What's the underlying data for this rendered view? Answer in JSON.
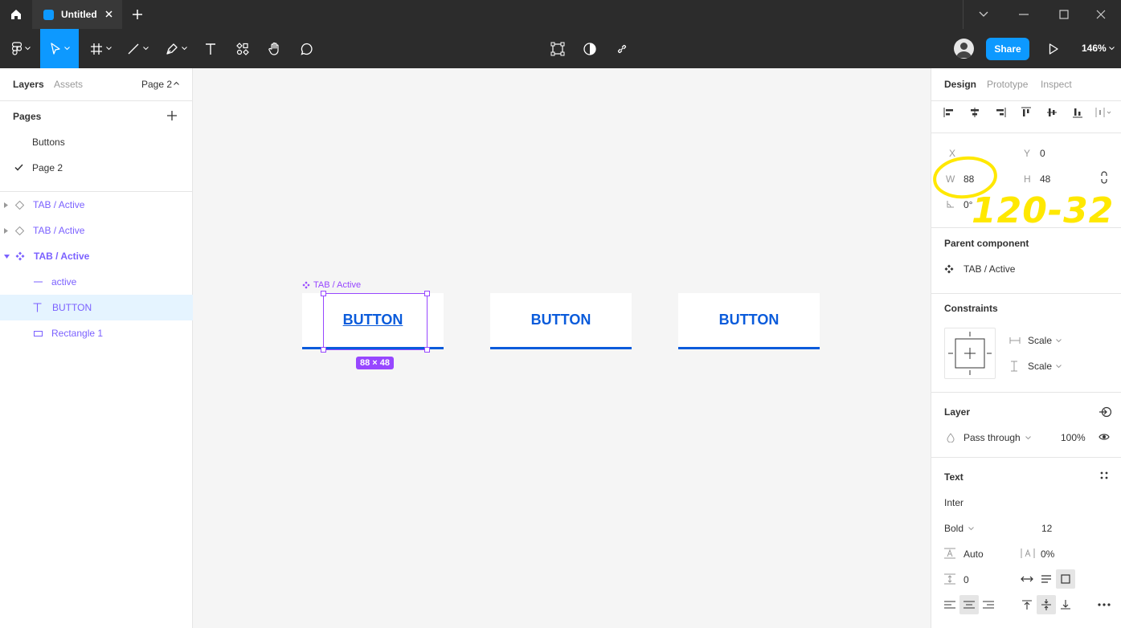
{
  "titlebar": {
    "tab_title": "Untitled"
  },
  "toolbar": {
    "share_label": "Share",
    "zoom_label": "146%"
  },
  "left_panel": {
    "tabs": {
      "layers": "Layers",
      "assets": "Assets",
      "page_dropdown": "Page 2"
    },
    "pages_title": "Pages",
    "pages": [
      {
        "label": "Buttons"
      },
      {
        "label": "Page 2"
      }
    ],
    "layers": [
      {
        "label": "TAB / Active"
      },
      {
        "label": "TAB / Active"
      },
      {
        "label": "TAB / Active"
      },
      {
        "label": "active"
      },
      {
        "label": "BUTTON"
      },
      {
        "label": "Rectangle 1"
      }
    ]
  },
  "canvas": {
    "frame_label": "TAB / Active",
    "buttons": [
      {
        "label": "BUTTON"
      },
      {
        "label": "BUTTON"
      },
      {
        "label": "BUTTON"
      }
    ],
    "size_badge": "88 × 48",
    "annotation": "120-32"
  },
  "right_panel": {
    "tabs": {
      "design": "Design",
      "prototype": "Prototype",
      "inspect": "Inspect"
    },
    "x_label": "X",
    "x_value": "",
    "y_label": "Y",
    "y_value": "0",
    "w_label": "W",
    "w_value": "88",
    "h_label": "H",
    "h_value": "48",
    "rotation_value": "0°",
    "parent_component_title": "Parent component",
    "parent_component_name": "TAB / Active",
    "constraints_title": "Constraints",
    "constraint_h": "Scale",
    "constraint_v": "Scale",
    "layer_title": "Layer",
    "blend_mode": "Pass through",
    "opacity": "100%",
    "text_title": "Text",
    "font_family": "Inter",
    "font_weight": "Bold",
    "font_size": "12",
    "line_height": "Auto",
    "letter_spacing": "0%",
    "paragraph_spacing": "0"
  },
  "colors": {
    "accent": "#0d99ff",
    "component": "#7b61ff",
    "selection": "#9747ff",
    "tab_blue": "#0a5bdb",
    "annotation": "#ffe800"
  }
}
